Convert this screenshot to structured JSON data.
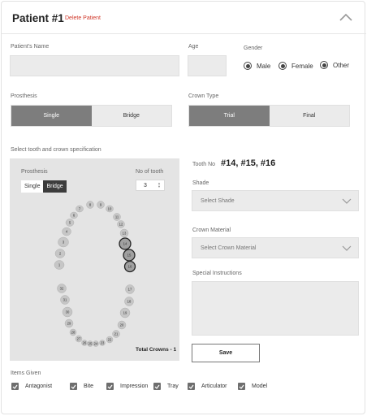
{
  "header": {
    "title": "Patient #1",
    "delete_label": "Delete Patient"
  },
  "patient_name": {
    "label": "Patient's Name",
    "value": ""
  },
  "age": {
    "label": "Age",
    "value": ""
  },
  "gender": {
    "label": "Gender",
    "options": [
      "Male",
      "Female",
      "Other"
    ],
    "selected": "Other"
  },
  "prosthesis": {
    "label": "Prosthesis",
    "options": [
      "Single",
      "Bridge"
    ],
    "selected": "Single"
  },
  "crown_type": {
    "label": "Crown Type",
    "options": [
      "Trial",
      "Final"
    ],
    "selected": "Trial"
  },
  "tooth_section": {
    "label": "Select tooth and crown specification",
    "prosthesis_label": "Prosthesis",
    "prosthesis_options": [
      "Single",
      "Bridge"
    ],
    "prosthesis_selected": "Bridge",
    "no_of_tooth_label": "No of tooth",
    "no_of_tooth_value": "3",
    "total_crowns": "Total Crowns - 1",
    "teeth": [
      "1",
      "2",
      "3",
      "4",
      "5",
      "6",
      "7",
      "8",
      "9",
      "10",
      "11",
      "12",
      "13",
      "14",
      "15",
      "16",
      "17",
      "18",
      "19",
      "20",
      "21",
      "22",
      "23",
      "24",
      "25",
      "26",
      "27",
      "28",
      "29",
      "30",
      "31",
      "32"
    ],
    "selected_teeth": [
      "14",
      "15",
      "16"
    ]
  },
  "tooth_no": {
    "label": "Tooth No",
    "value": "#14, #15, #16"
  },
  "shade": {
    "label": "Shade",
    "placeholder": "Select Shade"
  },
  "crown_material": {
    "label": "Crown Material",
    "placeholder": "Select Crown Material"
  },
  "special_instructions": {
    "label": "Special Instructions",
    "value": ""
  },
  "save_label": "Save",
  "items_given": {
    "label": "Items Given",
    "items": [
      {
        "label": "Antagonist",
        "checked": true
      },
      {
        "label": "Bite",
        "checked": true
      },
      {
        "label": "Impression",
        "checked": true
      },
      {
        "label": "Tray",
        "checked": true
      },
      {
        "label": "Articulator",
        "checked": true
      },
      {
        "label": "Model",
        "checked": true
      }
    ]
  }
}
